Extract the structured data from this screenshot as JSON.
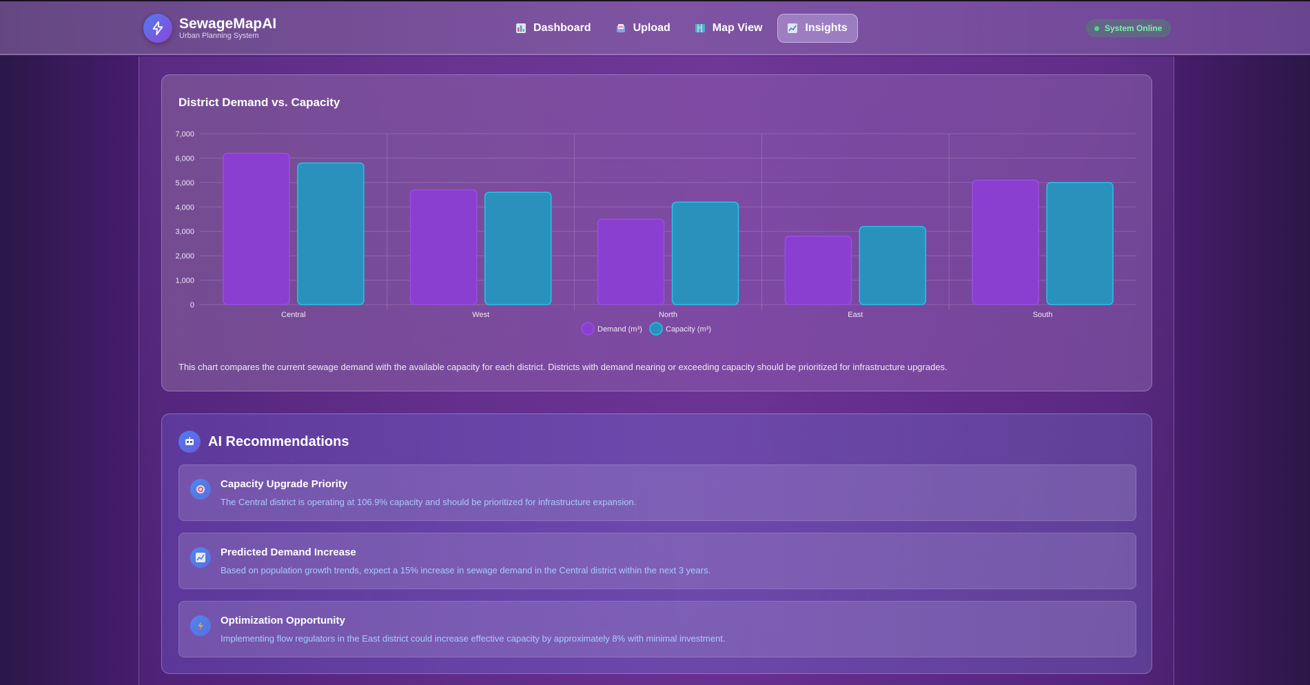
{
  "header": {
    "brand_name": "SewageMapAI",
    "brand_sub": "Urban Planning System",
    "nav": [
      {
        "label": "Dashboard",
        "icon": "bar-chart-icon",
        "color": "#e05a6a",
        "active": false
      },
      {
        "label": "Upload",
        "icon": "upload-icon",
        "color": "#e07aa0",
        "active": false
      },
      {
        "label": "Map View",
        "icon": "map-icon",
        "color": "#4ab0d0",
        "active": false
      },
      {
        "label": "Insights",
        "icon": "trend-icon",
        "color": "#8aa8e0",
        "active": true
      }
    ],
    "status": "System Online"
  },
  "chart_card": {
    "title": "District Demand vs. Capacity",
    "description": "This chart compares the current sewage demand with the available capacity for each district. Districts with demand nearing or exceeding capacity should be prioritized for infrastructure upgrades."
  },
  "chart_data": {
    "type": "bar",
    "categories": [
      "Central",
      "West",
      "North",
      "East",
      "South"
    ],
    "series": [
      {
        "name": "Demand (m³)",
        "values": [
          6200,
          4700,
          3500,
          2800,
          5100
        ],
        "color": "#8a3fd0",
        "stroke": "#9a4fe0"
      },
      {
        "name": "Capacity (m³)",
        "values": [
          5800,
          4600,
          4200,
          3200,
          5000
        ],
        "color": "#2a91bd",
        "stroke": "#25c4e6"
      }
    ],
    "yticks": [
      "0",
      "1,000",
      "2,000",
      "3,000",
      "4,000",
      "5,000",
      "6,000",
      "7,000"
    ],
    "ylim": [
      0,
      7000
    ],
    "grid": true,
    "legend": "bottom"
  },
  "recommendations": {
    "title": "AI Recommendations",
    "items": [
      {
        "title": "Capacity Upgrade Priority",
        "text": "The Central district is operating at 106.9% capacity and should be prioritized for infrastructure expansion.",
        "icon": "target-icon"
      },
      {
        "title": "Predicted Demand Increase",
        "text": "Based on population growth trends, expect a 15% increase in sewage demand in the Central district within the next 3 years.",
        "icon": "trend-icon"
      },
      {
        "title": "Optimization Opportunity",
        "text": "Implementing flow regulators in the East district could increase effective capacity by approximately 8% with minimal investment.",
        "icon": "bolt-icon"
      }
    ]
  }
}
